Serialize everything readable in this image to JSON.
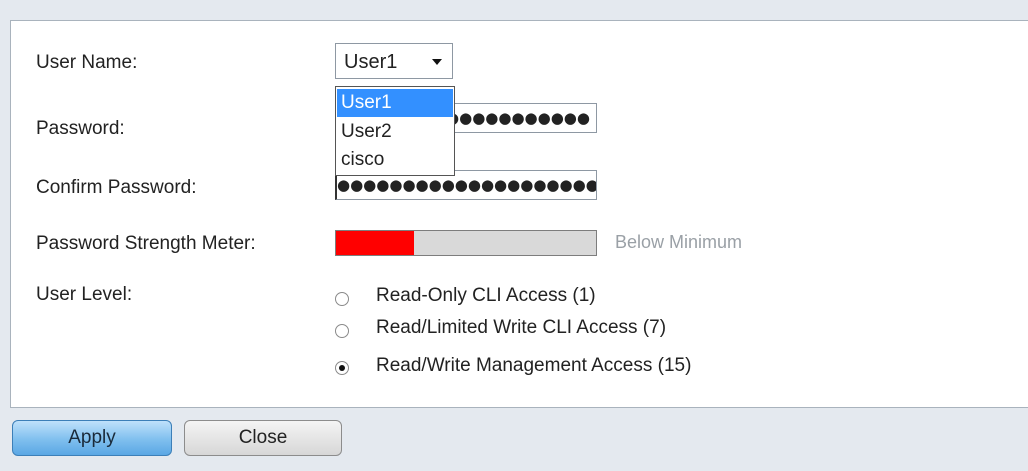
{
  "form": {
    "user_name_label": "User Name:",
    "password_label": "Password:",
    "confirm_password_label": "Confirm Password:",
    "strength_meter_label": "Password Strength Meter:",
    "user_level_label": "User Level:"
  },
  "user_select": {
    "selected": "User1",
    "options": [
      "User1",
      "User2",
      "cisco"
    ],
    "highlighted": "User1"
  },
  "password": {
    "masked": "●●●●●●●●●●●"
  },
  "confirm_password": {
    "masked": "●●●●●●●●●●●●●●●●●●●●"
  },
  "strength": {
    "fill_fraction": 0.3,
    "text": "Below Minimum",
    "fill_color": "#ff0000"
  },
  "user_levels": [
    {
      "label": "Read-Only CLI Access (1)",
      "selected": false
    },
    {
      "label": "Read/Limited Write CLI Access (7)",
      "selected": false
    },
    {
      "label": "Read/Write Management Access (15)",
      "selected": true
    }
  ],
  "buttons": {
    "apply": "Apply",
    "close": "Close"
  }
}
